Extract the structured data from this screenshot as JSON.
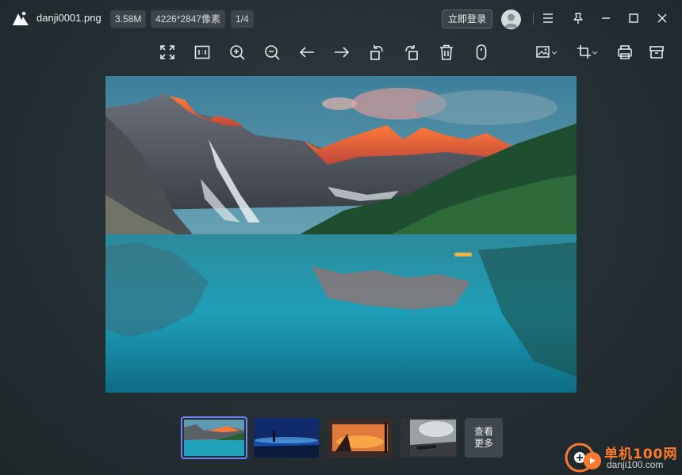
{
  "header": {
    "filename": "danji0001.png",
    "file_size": "3.58M",
    "dimensions": "4226*2847像素",
    "page_counter": "1/4",
    "login_label": "立即登录"
  },
  "toolbar": {
    "tools": [
      "fullscreen-icon",
      "actual-size-icon",
      "zoom-in-icon",
      "zoom-out-icon",
      "arrow-left-icon",
      "arrow-right-icon",
      "rotate-left-icon",
      "rotate-right-icon",
      "trash-icon",
      "mouse-icon",
      "image-edit-icon",
      "crop-icon",
      "print-icon",
      "archive-icon"
    ]
  },
  "thumbnails": {
    "items": [
      "mountain-lake",
      "night-silhouette",
      "sunset-window",
      "black-white-pier"
    ],
    "more_label_1": "查看",
    "more_label_2": "更多"
  },
  "watermark": {
    "brand": "单机100网",
    "site": "danji100.com"
  },
  "colors": {
    "accent": "#6f84ff",
    "watermark_orange": "#ff7a2d"
  }
}
